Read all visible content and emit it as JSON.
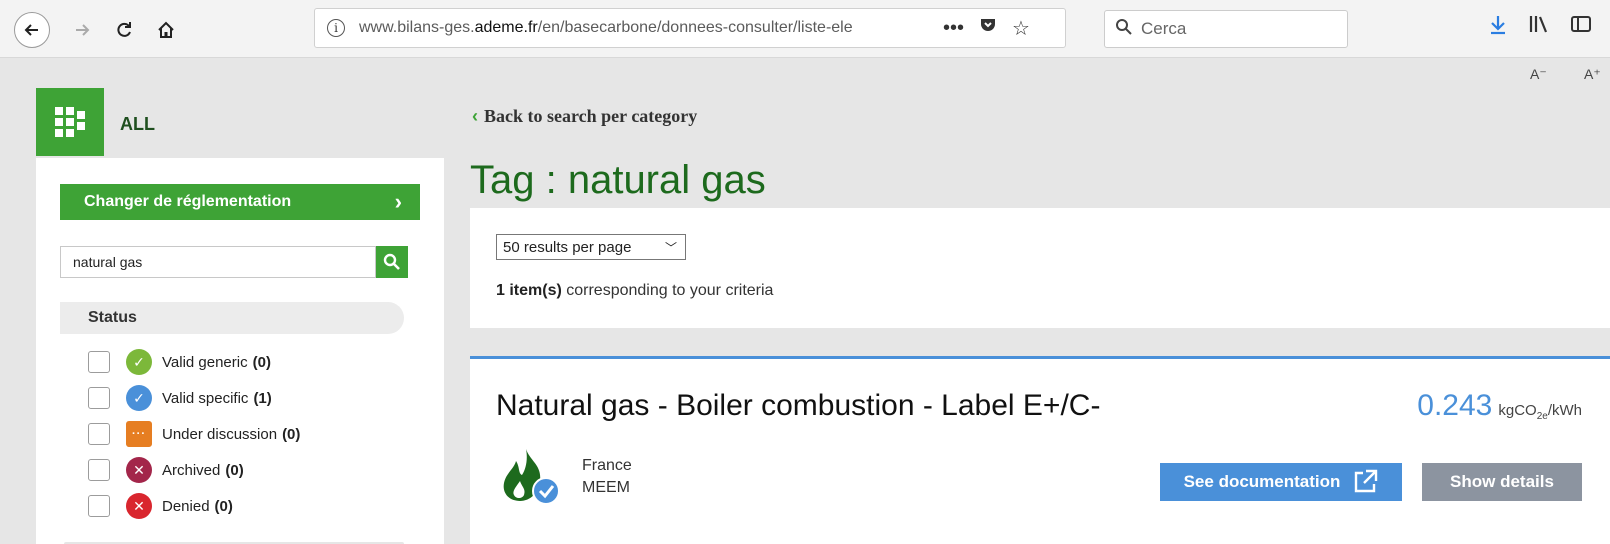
{
  "browser": {
    "url_prefix": "www.bilans-ges.",
    "url_domain": "ademe.fr",
    "url_path": "/en/basecarbone/donnees-consulter/liste-ele",
    "search_placeholder": "Cerca",
    "icons": [
      "back-icon",
      "forward-icon",
      "reload-icon",
      "home-icon",
      "info-icon",
      "more-icon",
      "pocket-icon",
      "star-icon",
      "search-icon",
      "download-icon",
      "library-icon",
      "sidebar-icon"
    ]
  },
  "font_controls": {
    "decrease": "A⁻",
    "increase": "A⁺"
  },
  "category": {
    "label": "ALL"
  },
  "sidebar": {
    "change_button": "Changer de réglementation",
    "search_value": "natural gas",
    "status_heading": "Status",
    "statuses": [
      {
        "label": "Valid generic",
        "count": "(0)",
        "color": "#7cb83a"
      },
      {
        "label": "Valid specific",
        "count": "(1)",
        "color": "#4a90d9"
      },
      {
        "label": "Under discussion",
        "count": "(0)",
        "color": "#e67e22"
      },
      {
        "label": "Archived",
        "count": "(0)",
        "color": "#a3264a"
      },
      {
        "label": "Denied",
        "count": "(0)",
        "color": "#d9262e"
      }
    ]
  },
  "main": {
    "back_link": "Back to search per category",
    "title": "Tag : natural gas",
    "per_page": "50 results per page",
    "count_bold": "1 item(s)",
    "count_rest": " corresponding to your criteria"
  },
  "item": {
    "title": "Natural gas - Boiler combustion - Label E+/C-",
    "value": "0.243",
    "unit_pre": "kgCO",
    "unit_sub": "2e",
    "unit_post": "/kWh",
    "country": "France",
    "source": "MEEM",
    "doc_button": "See documentation",
    "details_button": "Show details"
  },
  "colors": {
    "green": "#3ea336",
    "blue": "#4a90d9",
    "dark_green": "#1d6a1d"
  }
}
